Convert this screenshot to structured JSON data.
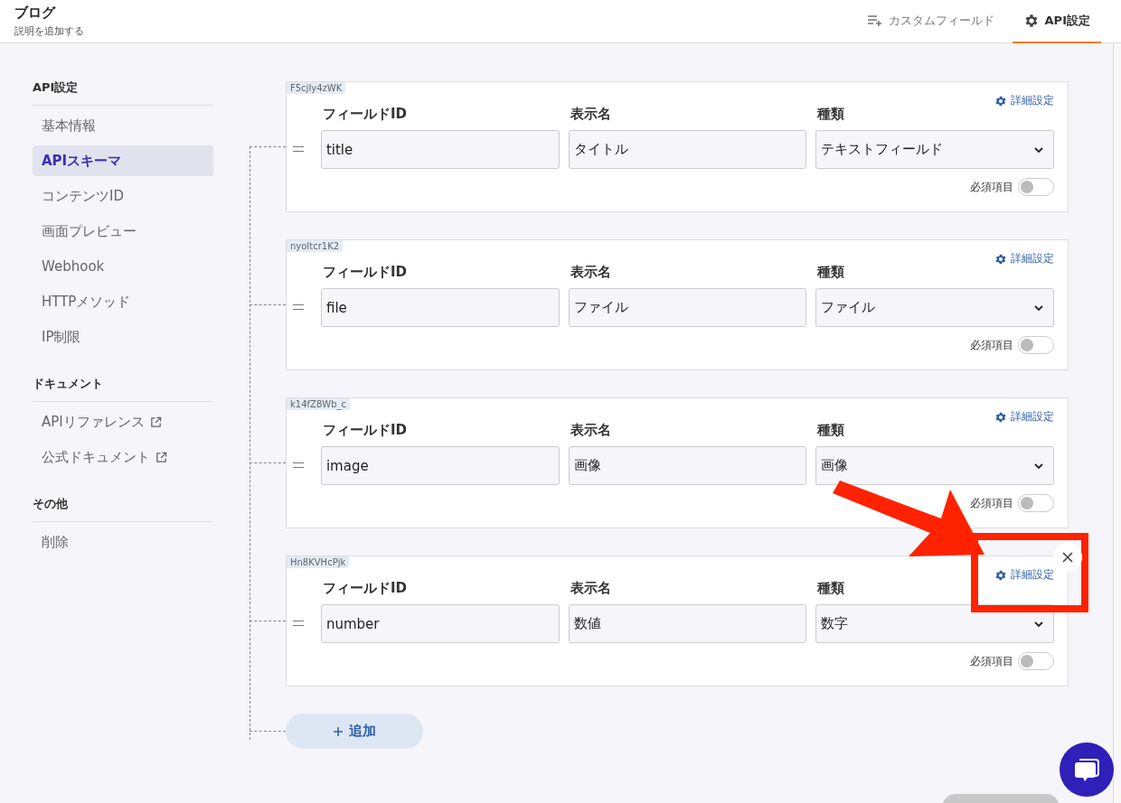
{
  "header": {
    "title": "ブログ",
    "description": "説明を追加する"
  },
  "header_tabs": [
    {
      "kind": "fields",
      "label": "カスタムフィールド",
      "selected": false
    },
    {
      "kind": "settings",
      "label": "API設定",
      "selected": true
    }
  ],
  "sidebar": [
    {
      "title": "API設定",
      "items": [
        {
          "label": "基本情報",
          "selected": false,
          "external": false
        },
        {
          "label": "APIスキーマ",
          "selected": true,
          "external": false
        },
        {
          "label": "コンテンツID",
          "selected": false,
          "external": false
        },
        {
          "label": "画面プレビュー",
          "selected": false,
          "external": false
        },
        {
          "label": "Webhook",
          "selected": false,
          "external": false
        },
        {
          "label": "HTTPメソッド",
          "selected": false,
          "external": false
        },
        {
          "label": "IP制限",
          "selected": false,
          "external": false
        }
      ]
    },
    {
      "title": "ドキュメント",
      "items": [
        {
          "label": "APIリファレンス",
          "selected": false,
          "external": true
        },
        {
          "label": "公式ドキュメント",
          "selected": false,
          "external": true
        }
      ]
    },
    {
      "title": "その他",
      "items": [
        {
          "label": "削除",
          "selected": false,
          "external": false
        }
      ]
    }
  ],
  "fields": [
    {
      "tag": "F5cjIy4zWK",
      "id_label": "フィールドID",
      "id_value": "title",
      "name_label": "表示名",
      "name_value": "タイトル",
      "type_label": "種類",
      "type_value": "テキストフィールド",
      "detail_link": "詳細設定",
      "required_label": "必須項目",
      "required": false,
      "close_visible": false,
      "highlighted": false
    },
    {
      "tag": "nyoItcr1K2",
      "id_label": "フィールドID",
      "id_value": "file",
      "name_label": "表示名",
      "name_value": "ファイル",
      "type_label": "種類",
      "type_value": "ファイル",
      "detail_link": "詳細設定",
      "required_label": "必須項目",
      "required": false,
      "close_visible": false,
      "highlighted": false
    },
    {
      "tag": "k14fZ8Wb_c",
      "id_label": "フィールドID",
      "id_value": "image",
      "name_label": "表示名",
      "name_value": "画像",
      "type_label": "種類",
      "type_value": "画像",
      "detail_link": "詳細設定",
      "required_label": "必須項目",
      "required": false,
      "close_visible": false,
      "highlighted": false
    },
    {
      "tag": "Hn8KVHcPjk",
      "id_label": "フィールドID",
      "id_value": "number",
      "name_label": "表示名",
      "name_value": "数値",
      "type_label": "種類",
      "type_value": "数字",
      "detail_link": "詳細設定",
      "required_label": "必須項目",
      "required": false,
      "close_visible": true,
      "highlighted": true
    }
  ],
  "add_button": "追加"
}
